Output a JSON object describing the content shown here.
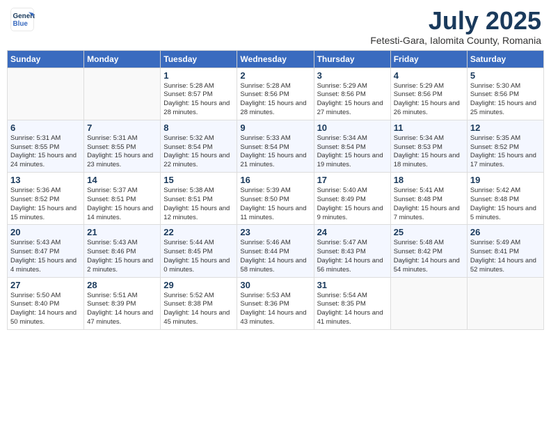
{
  "header": {
    "logo_line1": "General",
    "logo_line2": "Blue",
    "month_title": "July 2025",
    "location": "Fetesti-Gara, Ialomita County, Romania"
  },
  "weekdays": [
    "Sunday",
    "Monday",
    "Tuesday",
    "Wednesday",
    "Thursday",
    "Friday",
    "Saturday"
  ],
  "weeks": [
    [
      {
        "day": "",
        "sunrise": "",
        "sunset": "",
        "daylight": ""
      },
      {
        "day": "",
        "sunrise": "",
        "sunset": "",
        "daylight": ""
      },
      {
        "day": "1",
        "sunrise": "Sunrise: 5:28 AM",
        "sunset": "Sunset: 8:57 PM",
        "daylight": "Daylight: 15 hours and 28 minutes."
      },
      {
        "day": "2",
        "sunrise": "Sunrise: 5:28 AM",
        "sunset": "Sunset: 8:56 PM",
        "daylight": "Daylight: 15 hours and 28 minutes."
      },
      {
        "day": "3",
        "sunrise": "Sunrise: 5:29 AM",
        "sunset": "Sunset: 8:56 PM",
        "daylight": "Daylight: 15 hours and 27 minutes."
      },
      {
        "day": "4",
        "sunrise": "Sunrise: 5:29 AM",
        "sunset": "Sunset: 8:56 PM",
        "daylight": "Daylight: 15 hours and 26 minutes."
      },
      {
        "day": "5",
        "sunrise": "Sunrise: 5:30 AM",
        "sunset": "Sunset: 8:56 PM",
        "daylight": "Daylight: 15 hours and 25 minutes."
      }
    ],
    [
      {
        "day": "6",
        "sunrise": "Sunrise: 5:31 AM",
        "sunset": "Sunset: 8:55 PM",
        "daylight": "Daylight: 15 hours and 24 minutes."
      },
      {
        "day": "7",
        "sunrise": "Sunrise: 5:31 AM",
        "sunset": "Sunset: 8:55 PM",
        "daylight": "Daylight: 15 hours and 23 minutes."
      },
      {
        "day": "8",
        "sunrise": "Sunrise: 5:32 AM",
        "sunset": "Sunset: 8:54 PM",
        "daylight": "Daylight: 15 hours and 22 minutes."
      },
      {
        "day": "9",
        "sunrise": "Sunrise: 5:33 AM",
        "sunset": "Sunset: 8:54 PM",
        "daylight": "Daylight: 15 hours and 21 minutes."
      },
      {
        "day": "10",
        "sunrise": "Sunrise: 5:34 AM",
        "sunset": "Sunset: 8:54 PM",
        "daylight": "Daylight: 15 hours and 19 minutes."
      },
      {
        "day": "11",
        "sunrise": "Sunrise: 5:34 AM",
        "sunset": "Sunset: 8:53 PM",
        "daylight": "Daylight: 15 hours and 18 minutes."
      },
      {
        "day": "12",
        "sunrise": "Sunrise: 5:35 AM",
        "sunset": "Sunset: 8:52 PM",
        "daylight": "Daylight: 15 hours and 17 minutes."
      }
    ],
    [
      {
        "day": "13",
        "sunrise": "Sunrise: 5:36 AM",
        "sunset": "Sunset: 8:52 PM",
        "daylight": "Daylight: 15 hours and 15 minutes."
      },
      {
        "day": "14",
        "sunrise": "Sunrise: 5:37 AM",
        "sunset": "Sunset: 8:51 PM",
        "daylight": "Daylight: 15 hours and 14 minutes."
      },
      {
        "day": "15",
        "sunrise": "Sunrise: 5:38 AM",
        "sunset": "Sunset: 8:51 PM",
        "daylight": "Daylight: 15 hours and 12 minutes."
      },
      {
        "day": "16",
        "sunrise": "Sunrise: 5:39 AM",
        "sunset": "Sunset: 8:50 PM",
        "daylight": "Daylight: 15 hours and 11 minutes."
      },
      {
        "day": "17",
        "sunrise": "Sunrise: 5:40 AM",
        "sunset": "Sunset: 8:49 PM",
        "daylight": "Daylight: 15 hours and 9 minutes."
      },
      {
        "day": "18",
        "sunrise": "Sunrise: 5:41 AM",
        "sunset": "Sunset: 8:48 PM",
        "daylight": "Daylight: 15 hours and 7 minutes."
      },
      {
        "day": "19",
        "sunrise": "Sunrise: 5:42 AM",
        "sunset": "Sunset: 8:48 PM",
        "daylight": "Daylight: 15 hours and 5 minutes."
      }
    ],
    [
      {
        "day": "20",
        "sunrise": "Sunrise: 5:43 AM",
        "sunset": "Sunset: 8:47 PM",
        "daylight": "Daylight: 15 hours and 4 minutes."
      },
      {
        "day": "21",
        "sunrise": "Sunrise: 5:43 AM",
        "sunset": "Sunset: 8:46 PM",
        "daylight": "Daylight: 15 hours and 2 minutes."
      },
      {
        "day": "22",
        "sunrise": "Sunrise: 5:44 AM",
        "sunset": "Sunset: 8:45 PM",
        "daylight": "Daylight: 15 hours and 0 minutes."
      },
      {
        "day": "23",
        "sunrise": "Sunrise: 5:46 AM",
        "sunset": "Sunset: 8:44 PM",
        "daylight": "Daylight: 14 hours and 58 minutes."
      },
      {
        "day": "24",
        "sunrise": "Sunrise: 5:47 AM",
        "sunset": "Sunset: 8:43 PM",
        "daylight": "Daylight: 14 hours and 56 minutes."
      },
      {
        "day": "25",
        "sunrise": "Sunrise: 5:48 AM",
        "sunset": "Sunset: 8:42 PM",
        "daylight": "Daylight: 14 hours and 54 minutes."
      },
      {
        "day": "26",
        "sunrise": "Sunrise: 5:49 AM",
        "sunset": "Sunset: 8:41 PM",
        "daylight": "Daylight: 14 hours and 52 minutes."
      }
    ],
    [
      {
        "day": "27",
        "sunrise": "Sunrise: 5:50 AM",
        "sunset": "Sunset: 8:40 PM",
        "daylight": "Daylight: 14 hours and 50 minutes."
      },
      {
        "day": "28",
        "sunrise": "Sunrise: 5:51 AM",
        "sunset": "Sunset: 8:39 PM",
        "daylight": "Daylight: 14 hours and 47 minutes."
      },
      {
        "day": "29",
        "sunrise": "Sunrise: 5:52 AM",
        "sunset": "Sunset: 8:38 PM",
        "daylight": "Daylight: 14 hours and 45 minutes."
      },
      {
        "day": "30",
        "sunrise": "Sunrise: 5:53 AM",
        "sunset": "Sunset: 8:36 PM",
        "daylight": "Daylight: 14 hours and 43 minutes."
      },
      {
        "day": "31",
        "sunrise": "Sunrise: 5:54 AM",
        "sunset": "Sunset: 8:35 PM",
        "daylight": "Daylight: 14 hours and 41 minutes."
      },
      {
        "day": "",
        "sunrise": "",
        "sunset": "",
        "daylight": ""
      },
      {
        "day": "",
        "sunrise": "",
        "sunset": "",
        "daylight": ""
      }
    ]
  ]
}
